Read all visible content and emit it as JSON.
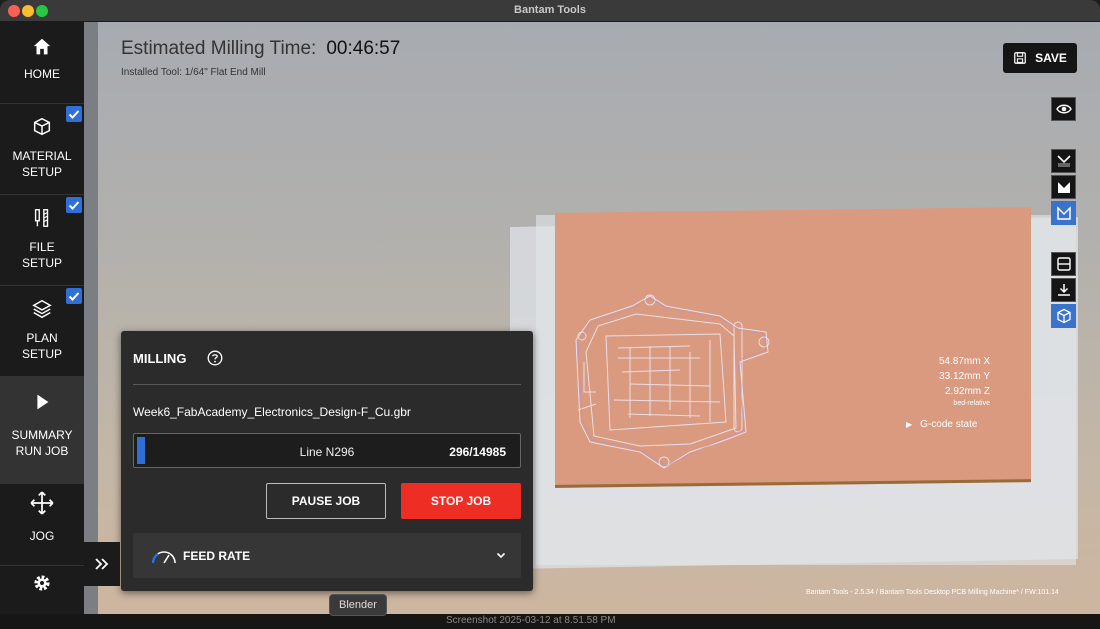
{
  "window": {
    "title": "Bantam Tools"
  },
  "sidebar": {
    "items": [
      {
        "label1": "HOME",
        "label2": "",
        "icon": "home-icon",
        "checked": false
      },
      {
        "label1": "MATERIAL",
        "label2": "SETUP",
        "icon": "material-icon",
        "checked": true
      },
      {
        "label1": "FILE",
        "label2": "SETUP",
        "icon": "tool-bits-icon",
        "checked": true
      },
      {
        "label1": "PLAN",
        "label2": "SETUP",
        "icon": "stack-icon",
        "checked": true
      },
      {
        "label1": "SUMMARY",
        "label2": "RUN JOB",
        "icon": "play-icon",
        "checked": false,
        "active": true
      },
      {
        "label1": "JOG",
        "label2": "",
        "icon": "move-arrows-icon",
        "checked": false
      },
      {
        "label1": "",
        "label2": "",
        "icon": "gear-icon",
        "checked": false
      }
    ]
  },
  "header": {
    "estimate_label": "Estimated Milling Time:",
    "estimate_value": "00:46:57",
    "installed_tool": "Installed Tool: 1/64\" Flat End Mill"
  },
  "toolbar": {
    "save_label": "SAVE"
  },
  "viewport": {
    "coord_x": "54.87mm X",
    "coord_y": "33.12mm Y",
    "coord_z": "2.92mm Z",
    "coord_note": "bed-relative",
    "gcode_state": "G-code state",
    "footer": "Bantam Tools - 2.5.34 / Bantam Tools Desktop PCB Milling Machine* / FW:101.14"
  },
  "panel": {
    "title": "MILLING",
    "filename": "Week6_FabAcademy_Electronics_Design-F_Cu.gbr",
    "progress_line": "Line N296",
    "progress_count": "296/14985",
    "progress_fraction": 0.0198,
    "pause_label": "PAUSE JOB",
    "stop_label": "STOP JOB",
    "feed_label": "FEED RATE"
  },
  "tooltip": {
    "label": "Blender"
  },
  "dock": {
    "screenshot_label": "Screenshot 2025-03-12 at 8.51.58 PM"
  },
  "colors": {
    "accent": "#2f6fd6",
    "stop": "#ee2e24",
    "copper": "#d99a80"
  }
}
